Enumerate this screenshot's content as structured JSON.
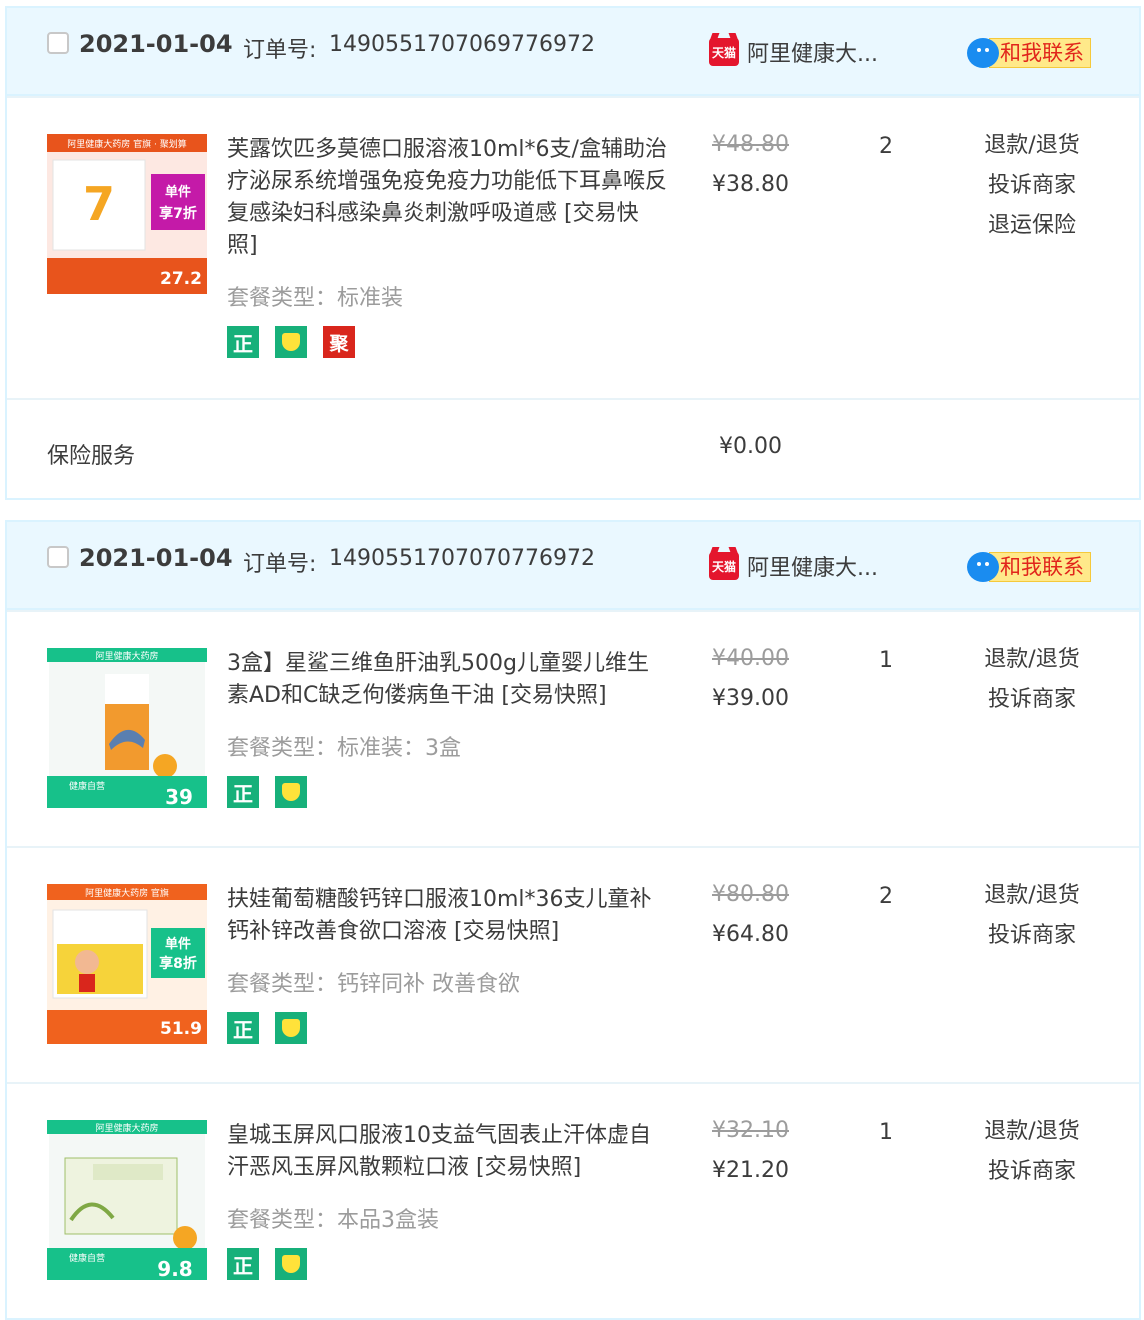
{
  "orders": [
    {
      "date": "2021-01-04",
      "order_no_label": "订单号:",
      "order_no": "1490551707069776972",
      "shop_name": "阿里健康大...",
      "contact_label": "和我联系",
      "items": [
        {
          "title": "芙露饮匹多莫德口服溶液10ml*6支/盒辅助治疗泌尿系统增强免疫免疫力功能低下耳鼻喉反复感染妇科感染鼻炎刺激呼吸道感",
          "snapshot": "[交易快照]",
          "sku": "套餐类型：标准装",
          "badges": [
            "正",
            "保",
            "聚"
          ],
          "original_price": "¥48.80",
          "price": "¥38.80",
          "quantity": "2",
          "ops": [
            "退款/退货",
            "投诉商家",
            "退运保险"
          ],
          "thumb": {
            "top_text": "阿里健康大药房 官旗 · 聚划算",
            "left_text": "单件",
            "right_text": "享7折",
            "price": "27.2",
            "accent": "#e8541c",
            "panel": "#c41aa8"
          }
        }
      ],
      "insurance": {
        "label": "保险服务",
        "price": "¥0.00"
      }
    },
    {
      "date": "2021-01-04",
      "order_no_label": "订单号:",
      "order_no": "1490551707070776972",
      "shop_name": "阿里健康大...",
      "contact_label": "和我联系",
      "items": [
        {
          "title": "3盒】星鲨三维鱼肝油乳500g儿童婴儿维生素AD和C缺乏佝偻病鱼干油",
          "snapshot": "[交易快照]",
          "sku": "套餐类型：标准装：3盒",
          "badges": [
            "正",
            "保"
          ],
          "original_price": "¥40.00",
          "price": "¥39.00",
          "quantity": "1",
          "ops": [
            "退款/退货",
            "投诉商家"
          ],
          "thumb": {
            "top_text": "阿里健康大药房",
            "left_text": "健康自营",
            "right_text": "",
            "price": "39",
            "accent": "#17c18a",
            "panel": "#17c18a"
          }
        },
        {
          "title": "扶娃葡萄糖酸钙锌口服液10ml*36支儿童补钙补锌改善食欲口溶液",
          "snapshot": "[交易快照]",
          "sku": "套餐类型：钙锌同补 改善食欲",
          "badges": [
            "正",
            "保"
          ],
          "original_price": "¥80.80",
          "price": "¥64.80",
          "quantity": "2",
          "ops": [
            "退款/退货",
            "投诉商家"
          ],
          "thumb": {
            "top_text": "阿里健康大药房 官旗",
            "left_text": "单件",
            "right_text": "享8折",
            "price": "51.9",
            "accent": "#f0621e",
            "panel": "#17c18a"
          }
        },
        {
          "title": "皇城玉屏风口服液10支益气固表止汗体虚自汗恶风玉屏风散颗粒口液",
          "snapshot": "[交易快照]",
          "sku": "套餐类型：本品3盒装",
          "badges": [
            "正",
            "保"
          ],
          "original_price": "¥32.10",
          "price": "¥21.20",
          "quantity": "1",
          "ops": [
            "退款/退货",
            "投诉商家"
          ],
          "thumb": {
            "top_text": "阿里健康大药房",
            "left_text": "健康自营",
            "right_text": "",
            "price": "9.8",
            "accent": "#17c18a",
            "panel": "#17c18a"
          }
        }
      ]
    }
  ],
  "colors": {
    "header_bg": "#eaf8ff",
    "border": "#daf3ff",
    "muted": "#9c9c9c",
    "badge_green": "#17b07a",
    "badge_red": "#d9261c",
    "tmall_red": "#e4162d"
  }
}
